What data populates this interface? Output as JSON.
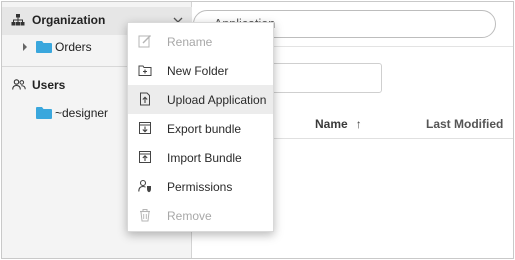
{
  "tree": {
    "root_label": "Organization",
    "items": [
      {
        "label": "Orders"
      }
    ],
    "users_label": "Users",
    "user_items": [
      {
        "label": "~designer"
      }
    ]
  },
  "search": {
    "placeholder": "Application",
    "value": ""
  },
  "table": {
    "columns": [
      {
        "label": "Name",
        "sort": "ascending"
      },
      {
        "label": "Last Modified"
      }
    ]
  },
  "context_menu": {
    "items": [
      {
        "label": "Rename",
        "icon": "edit-icon",
        "enabled": false
      },
      {
        "label": "New Folder",
        "icon": "new-folder-icon",
        "enabled": true
      },
      {
        "label": "Upload Application",
        "icon": "upload-application-icon",
        "enabled": true,
        "highlighted": true
      },
      {
        "label": "Export bundle",
        "icon": "export-bundle-icon",
        "enabled": true
      },
      {
        "label": "Import Bundle",
        "icon": "import-bundle-icon",
        "enabled": true
      },
      {
        "label": "Permissions",
        "icon": "permissions-icon",
        "enabled": true
      },
      {
        "label": "Remove",
        "icon": "trash-icon",
        "enabled": false
      }
    ]
  },
  "colors": {
    "folder": "#3aa7dd",
    "highlight": "#ececec",
    "disabled_text": "#a8a8a8",
    "panel_bg": "#f4f4f4"
  }
}
